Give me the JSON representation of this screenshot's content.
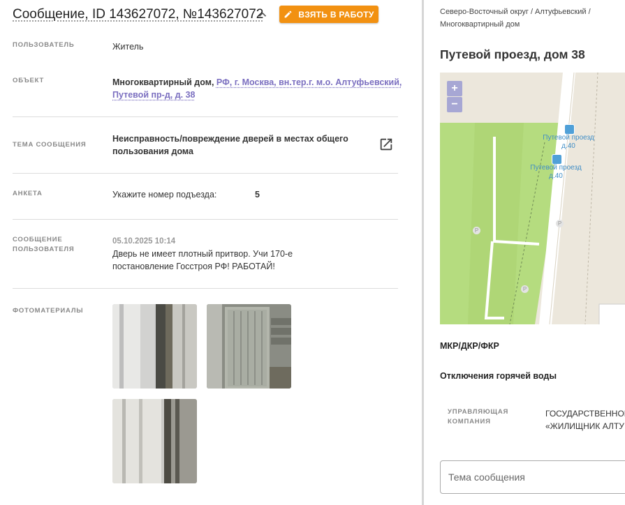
{
  "header": {
    "title": "Сообщение, ID 143627072, №143627072",
    "take_button": "ВЗЯТЬ В РАБОТУ"
  },
  "fields": {
    "user": {
      "label": "ПОЛЬЗОВАТЕЛЬ",
      "value": "Житель"
    },
    "object": {
      "label": "ОБЪЕКТ",
      "type": "Многоквартирный дом,",
      "address_line1": "РФ, г. Москва, вн.тер.г. м.о. Алтуфьевский,",
      "address_line2": "Путевой пр-д, д. 38"
    },
    "topic": {
      "label": "ТЕМА СООБЩЕНИЯ",
      "line1": "Неисправность/повреждение дверей в местах общего",
      "line2": "пользования дома"
    },
    "survey": {
      "label": "АНКЕТА",
      "question": "Укажите номер подъезда:",
      "answer": "5"
    },
    "message": {
      "label_line1": "СООБЩЕНИЕ",
      "label_line2": "ПОЛЬЗОВАТЕЛЯ",
      "date": "05.10.2025 10:14",
      "line1": "Дверь не имеет плотный притвор. Учи 170-е",
      "line2": "постановление Госстроя РФ! РАБОТАЙ!"
    },
    "photos": {
      "label": "ФОТОМАТЕРИАЛЫ",
      "count": 3
    }
  },
  "side": {
    "breadcrumb_line1": "Северо-Восточный округ / Алтуфьевский /",
    "breadcrumb_line2": "Многоквартирный дом",
    "address": "Путевой проезд, дом 38",
    "map": {
      "zoom_in": "+",
      "zoom_out": "−",
      "stop1_line1": "Путевой проезд",
      "stop1_line2": "д.40",
      "stop2_line1": "Путевой проезд",
      "stop2_line2": "д.40",
      "parking": "P"
    },
    "mkr": "МКР/ДКР/ФКР",
    "outage": "Отключения горячей воды",
    "management": {
      "label_line1": "УПРАВЛЯЮЩАЯ",
      "label_line2": "КОМПАНИЯ",
      "value_line1": "ГОСУДАРСТВЕННОЕ",
      "value_line2": "«ЖИЛИЩНИК АЛТУ"
    },
    "subject_placeholder": "Тема сообщения"
  },
  "colors": {
    "accent": "#f29111",
    "link": "#7b6fc0",
    "map_green": "#b5dc7f",
    "map_sand": "#ece7dc"
  }
}
